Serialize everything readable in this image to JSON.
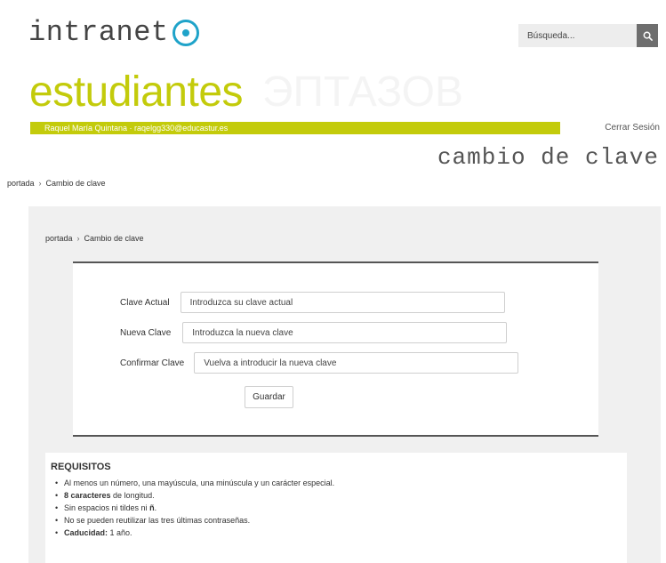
{
  "header": {
    "logo_text": "intranet",
    "search_placeholder": "Búsqueda...",
    "section_title": "estudiantes",
    "section_ghost": "ЭПТАЗОВ",
    "user_info": "Raquel María Quintana · raqelgg330@educastur.es",
    "logout_label": "Cerrar Sesión",
    "accent_color": "#c3cb0b",
    "logo_color": "#1fa3c9"
  },
  "page": {
    "heading": "cambio de clave"
  },
  "breadcrumb": {
    "home": "portada",
    "separator": "›",
    "current": "Cambio de clave"
  },
  "form": {
    "current_label": "Clave Actual",
    "current_placeholder": "Introduzca su clave actual",
    "new_label": "Nueva Clave",
    "new_placeholder": "Introduzca la nueva clave",
    "confirm_label": "Confirmar Clave",
    "confirm_placeholder": "Vuelva a introducir la nueva clave",
    "save_label": "Guardar"
  },
  "requirements": {
    "title": "REQUISITOS",
    "items": [
      {
        "pre": "Al menos un número, una mayúscula, una minúscula y un carácter especial.",
        "bold": "",
        "post": ""
      },
      {
        "pre": "",
        "bold": "8 caracteres",
        "post": " de longitud."
      },
      {
        "pre": "Sin espacios ni tildes ni ",
        "bold": "ñ",
        "post": "."
      },
      {
        "pre": "No se pueden reutilizar las tres últimas contraseñas.",
        "bold": "",
        "post": ""
      },
      {
        "pre": "",
        "bold": "Caducidad:",
        "post": " 1 año."
      }
    ]
  }
}
